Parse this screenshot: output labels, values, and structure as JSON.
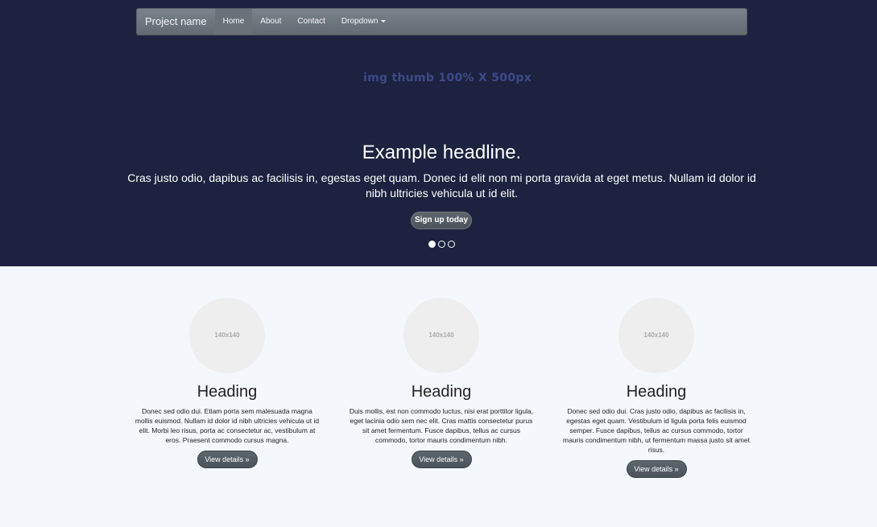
{
  "navbar": {
    "brand": "Project name",
    "items": [
      {
        "label": "Home",
        "active": true
      },
      {
        "label": "About",
        "active": false
      },
      {
        "label": "Contact",
        "active": false
      },
      {
        "label": "Dropdown",
        "active": false
      }
    ]
  },
  "carousel": {
    "placeholder_text": "img thumb 100% X 500px",
    "headline": "Example headline.",
    "lead": "Cras justo odio, dapibus ac facilisis in, egestas eget quam. Donec id elit non mi porta gravida at eget metus. Nullam id dolor id nibh ultricies vehicula ut id elit.",
    "button_label": "Sign up today",
    "indicators": [
      {
        "active": true
      },
      {
        "active": false
      },
      {
        "active": false
      }
    ]
  },
  "columns": [
    {
      "image_label": "140x140",
      "heading": "Heading",
      "text": "Donec sed odio dui. Etiam porta sem malesuada magna mollis euismod. Nullam id dolor id nibh ultricies vehicula ut id elit. Morbi leo risus, porta ac consectetur ac, vestibulum at eros. Praesent commodo cursus magna.",
      "button_label": "View details »"
    },
    {
      "image_label": "140x140",
      "heading": "Heading",
      "text": "Duis mollis, est non commodo luctus, nisi erat porttitor ligula, eget lacinia odio sem nec elit. Cras mattis consectetur purus sit amet fermentum. Fusce dapibus, tellus ac cursus commodo, tortor mauris condimentum nibh.",
      "button_label": "View details »"
    },
    {
      "image_label": "140x140",
      "heading": "Heading",
      "text": "Donec sed odio dui. Cras justo odio, dapibus ac facilisis in, egestas eget quam. Vestibulum id ligula porta felis euismod semper. Fusce dapibus, tellus ac cursus commodo, tortor mauris condimentum nibh, ut fermentum massa justo sit amet risus.",
      "button_label": "View details »"
    }
  ]
}
